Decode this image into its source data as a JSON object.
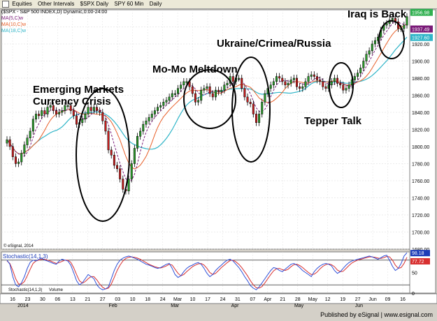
{
  "toolbar": {
    "items": [
      "Equities",
      "Other Intervals",
      "$SPX Daily",
      "SPY 60 Min",
      "Daily"
    ]
  },
  "header": {
    "symbol": "($SPX - S&P 500 INDEX,D) Dynamic,0:00-24:00",
    "ma_labels": [
      "MA(5,C)w",
      "MA(10,C)w",
      "MA(18,C)w"
    ]
  },
  "annotations": {
    "emerging_1": "Emerging Markets",
    "emerging_2": "Currency Crisis",
    "momo": "Mo-Mo Meltdown",
    "ukraine": "Ukraine/Crimea/Russia",
    "tepper": "Tepper Talk",
    "iraq": "Iraq is Back"
  },
  "footer": "Published by eSignal | www.esignal.com",
  "osc_tabs": [
    "Stochastic(14,1,3)",
    "Volume"
  ],
  "stoch_title": "Stochastic(14,1,3)",
  "stoch_values": [
    "98.18",
    "77.72"
  ],
  "price_tags": [
    "1956.98",
    "1937.49",
    "1927.60"
  ],
  "copyright": "© eSignal, 2014",
  "colors": {
    "bg": "#ffffff",
    "up": "#2a9d2a",
    "down": "#c81e1e",
    "ma5": "#7a1a78",
    "ma10": "#e8602a",
    "ma18": "#30b5c8",
    "stoch_k": "#2e4fd8",
    "stoch_d": "#d83030"
  },
  "chart_data": {
    "type": "candlestick",
    "ylim": [
      1680,
      1960
    ],
    "y_ticks": [
      1680,
      1700,
      1720,
      1740,
      1760,
      1780,
      1800,
      1820,
      1840,
      1860,
      1880,
      1900,
      1920,
      1940
    ],
    "x_tick_labels": [
      "16",
      "23",
      "30",
      "06",
      "13",
      "21",
      "27",
      "03",
      "10",
      "18",
      "24",
      "Mar",
      "10",
      "17",
      "24",
      "31",
      "07",
      "Apr",
      "21",
      "28",
      "May",
      "12",
      "19",
      "27",
      "Jun",
      "09",
      "16"
    ],
    "x_sub_labels": [
      "2014",
      "Feb",
      "Mar",
      "Apr",
      "May",
      "Jun"
    ],
    "closes": [
      1808,
      1800,
      1788,
      1780,
      1782,
      1792,
      1802,
      1810,
      1818,
      1832,
      1838,
      1836,
      1842,
      1838,
      1846,
      1848,
      1842,
      1838,
      1840,
      1842,
      1848,
      1848,
      1842,
      1836,
      1826,
      1828,
      1832,
      1838,
      1846,
      1842,
      1846,
      1842,
      1840,
      1830,
      1818,
      1796,
      1790,
      1778,
      1774,
      1762,
      1750,
      1748,
      1762,
      1780,
      1798,
      1812,
      1818,
      1826,
      1830,
      1834,
      1838,
      1842,
      1846,
      1848,
      1852,
      1854,
      1858,
      1862,
      1862,
      1868,
      1872,
      1876,
      1876,
      1870,
      1862,
      1852,
      1854,
      1866,
      1868,
      1870,
      1862,
      1858,
      1866,
      1864,
      1866,
      1872,
      1874,
      1882,
      1876,
      1880,
      1880,
      1868,
      1858,
      1852,
      1850,
      1838,
      1828,
      1838,
      1852,
      1862,
      1868,
      1872,
      1876,
      1882,
      1880,
      1876,
      1872,
      1874,
      1878,
      1880,
      1870,
      1868,
      1870,
      1876,
      1882,
      1884,
      1882,
      1878,
      1876,
      1870,
      1868,
      1872,
      1876,
      1880,
      1874,
      1872,
      1866,
      1868,
      1872,
      1878,
      1882,
      1886,
      1892,
      1900,
      1908,
      1912,
      1920,
      1924,
      1928,
      1936,
      1942,
      1944,
      1948,
      1950,
      1946,
      1938,
      1938,
      1942,
      1952
    ],
    "stoch_k": [
      80,
      70,
      40,
      20,
      15,
      25,
      40,
      60,
      75,
      80,
      78,
      82,
      85,
      80,
      78,
      75,
      72,
      70,
      78,
      82,
      80,
      78,
      68,
      50,
      30,
      20,
      25,
      35,
      45,
      40,
      35,
      20,
      12,
      8,
      10,
      15,
      35,
      55,
      70,
      80,
      85,
      88,
      90,
      88,
      85,
      82,
      78,
      74,
      70,
      68,
      65,
      62,
      60,
      62,
      66,
      70,
      72,
      60,
      45,
      38,
      42,
      52,
      60,
      65,
      68,
      72,
      74,
      70,
      60,
      48,
      40,
      45,
      55,
      62,
      68,
      75,
      80,
      82,
      78,
      70,
      62,
      52,
      40,
      30,
      18,
      12,
      8,
      15,
      25,
      35,
      45,
      55,
      62,
      60,
      55,
      52,
      58,
      64,
      70,
      72,
      68,
      62,
      55,
      50,
      45,
      40,
      52,
      60,
      66,
      70,
      72,
      70,
      66,
      55,
      48,
      52,
      60,
      68,
      74,
      78,
      80,
      82,
      84,
      86,
      88,
      90,
      88,
      85,
      82,
      86,
      90,
      92,
      80,
      65,
      55,
      60,
      72,
      90,
      98
    ],
    "stoch_d": [
      78,
      72,
      55,
      35,
      22,
      22,
      28,
      42,
      58,
      72,
      78,
      80,
      82,
      82,
      80,
      78,
      75,
      72,
      74,
      77,
      80,
      80,
      75,
      62,
      45,
      30,
      24,
      28,
      35,
      40,
      40,
      32,
      22,
      14,
      10,
      12,
      22,
      38,
      55,
      68,
      78,
      84,
      87,
      88,
      87,
      85,
      82,
      78,
      74,
      70,
      67,
      64,
      62,
      61,
      63,
      66,
      70,
      68,
      58,
      48,
      42,
      45,
      52,
      58,
      64,
      68,
      71,
      72,
      68,
      60,
      50,
      45,
      48,
      55,
      62,
      68,
      74,
      79,
      80,
      76,
      70,
      62,
      52,
      42,
      30,
      20,
      13,
      12,
      16,
      25,
      35,
      45,
      54,
      59,
      60,
      57,
      55,
      58,
      64,
      69,
      70,
      67,
      62,
      56,
      50,
      45,
      46,
      51,
      59,
      65,
      69,
      71,
      69,
      64,
      56,
      52,
      53,
      60,
      67,
      73,
      77,
      80,
      82,
      84,
      86,
      88,
      88,
      87,
      85,
      84,
      86,
      89,
      88,
      80,
      68,
      60,
      62,
      72,
      87
    ]
  }
}
